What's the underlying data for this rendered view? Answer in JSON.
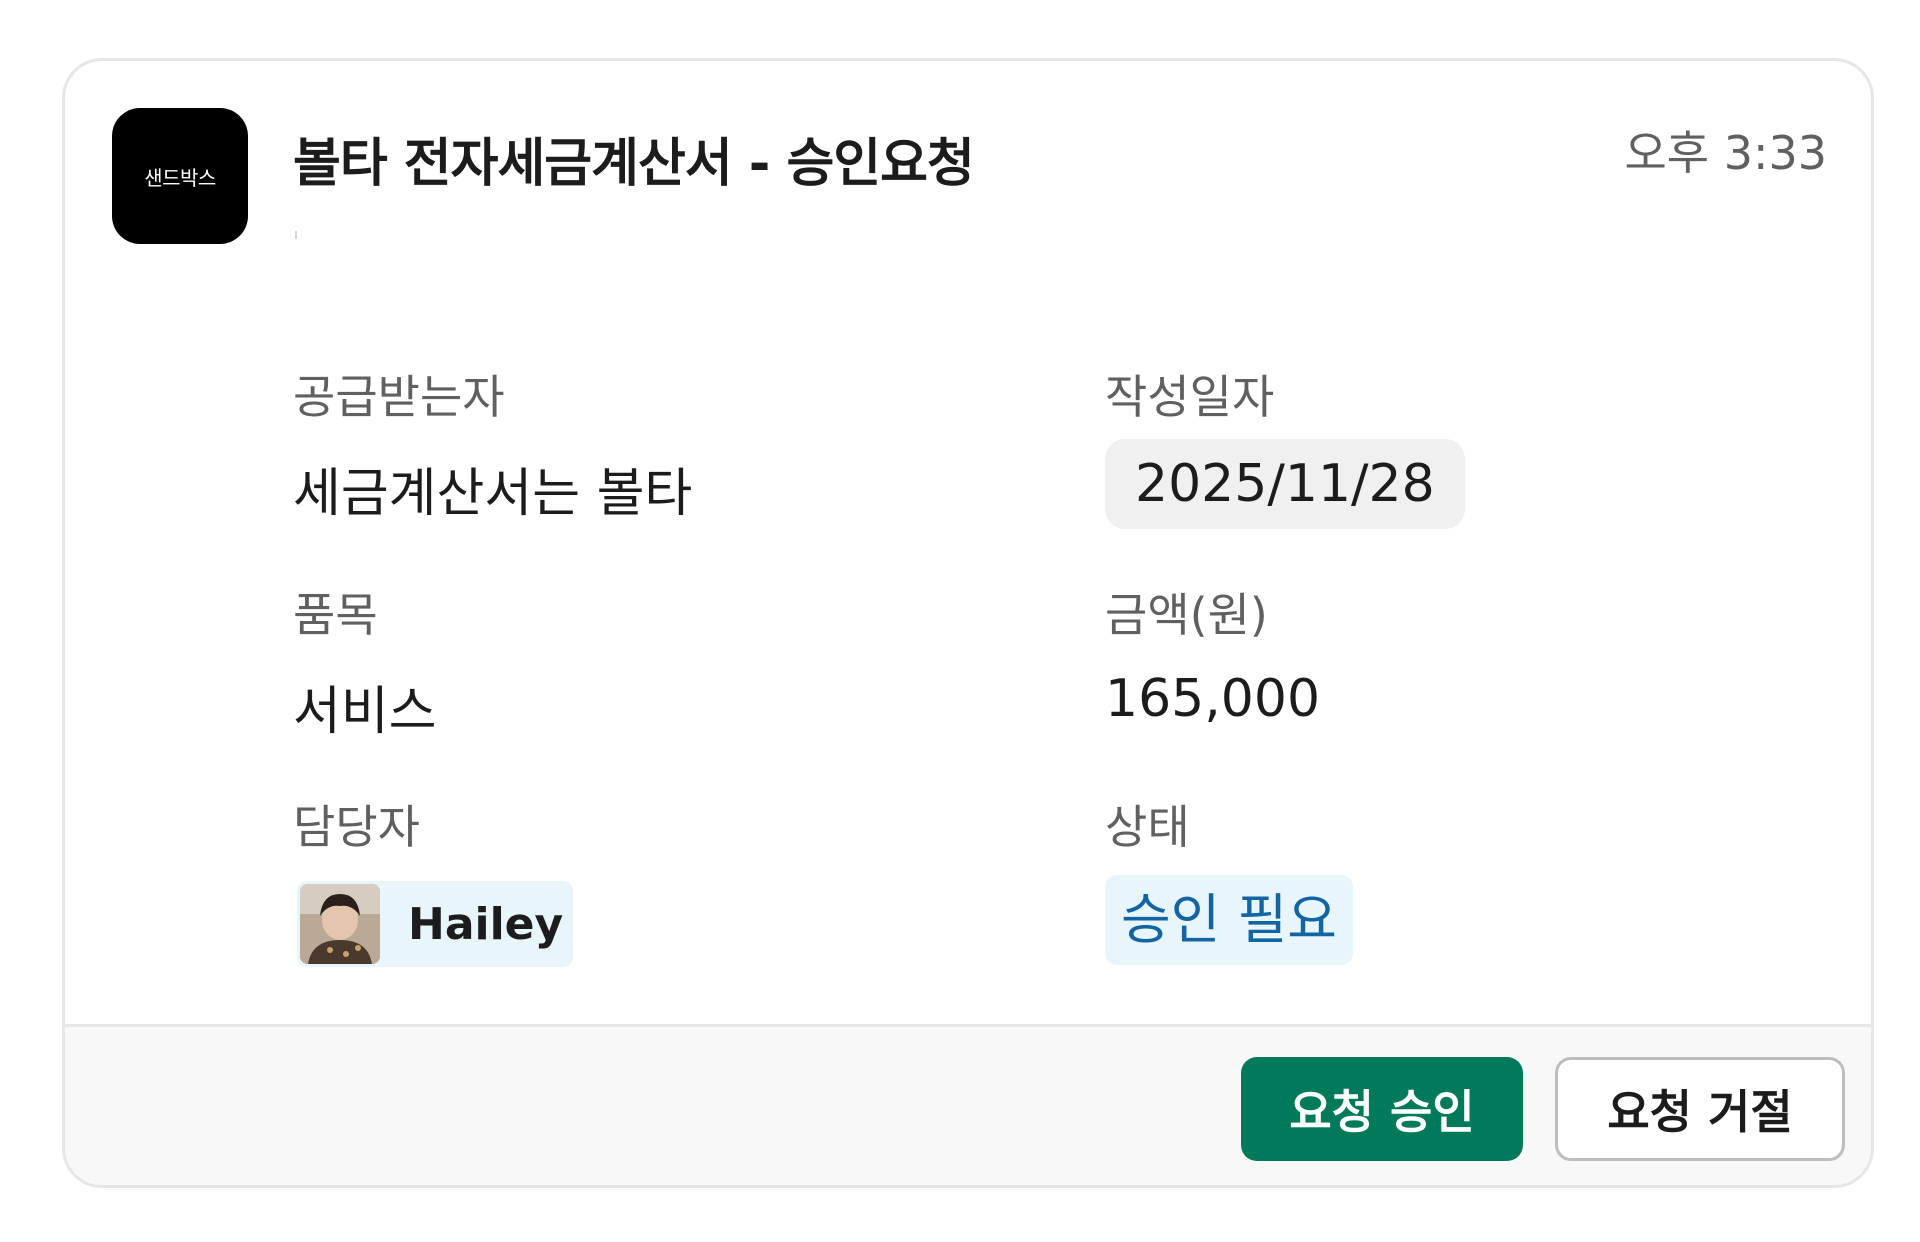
{
  "app": {
    "logo_text": "샌드박스"
  },
  "message": {
    "title": "볼타 전자세금계산서 - 승인요청",
    "time": "오후 3:33"
  },
  "fields": {
    "recipient": {
      "label": "공급받는자",
      "value": "세금계산서는 볼타"
    },
    "issue_date": {
      "label": "작성일자",
      "value": "2025/11/28"
    },
    "item": {
      "label": "품목",
      "value": "서비스"
    },
    "amount": {
      "label": "금액(원)",
      "value": "165,000"
    },
    "manager": {
      "label": "담당자",
      "name": "Hailey"
    },
    "status": {
      "label": "상태",
      "value": "승인 필요"
    }
  },
  "actions": {
    "approve_label": "요청 승인",
    "reject_label": "요청 거절"
  },
  "colors": {
    "approve_button": "#007a5a",
    "status_text": "#1264a3",
    "status_bg": "#e8f5fa"
  }
}
